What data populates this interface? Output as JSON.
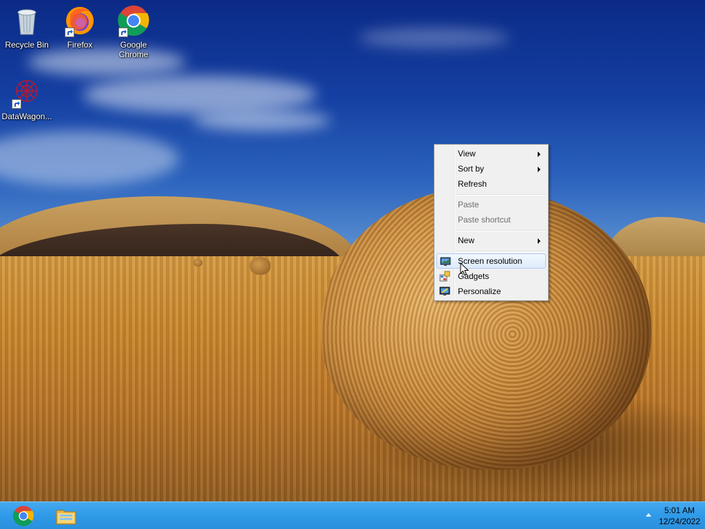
{
  "desktop": {
    "icons": [
      {
        "label": "Recycle Bin",
        "icon": "recycle-bin-icon"
      },
      {
        "label": "Firefox",
        "icon": "firefox-icon"
      },
      {
        "label": "Google Chrome",
        "icon": "chrome-icon"
      },
      {
        "label": "DataWagon...",
        "icon": "datawagon-icon"
      }
    ]
  },
  "context_menu": {
    "items": [
      {
        "label": "View",
        "submenu": true,
        "enabled": true
      },
      {
        "label": "Sort by",
        "submenu": true,
        "enabled": true
      },
      {
        "label": "Refresh",
        "submenu": false,
        "enabled": true
      },
      {
        "label": "Paste",
        "submenu": false,
        "enabled": false
      },
      {
        "label": "Paste shortcut",
        "submenu": false,
        "enabled": false
      },
      {
        "label": "New",
        "submenu": true,
        "enabled": true
      },
      {
        "label": "Screen resolution",
        "icon": "screen-resolution-icon",
        "enabled": true,
        "highlighted": true
      },
      {
        "label": "Gadgets",
        "icon": "gadgets-icon",
        "enabled": true
      },
      {
        "label": "Personalize",
        "icon": "personalize-icon",
        "enabled": true
      }
    ]
  },
  "taskbar": {
    "pinned": [
      {
        "icon": "chrome-icon"
      },
      {
        "icon": "file-explorer-icon"
      }
    ],
    "tray": {
      "time": "5:01 AM",
      "date": "12/24/2022"
    }
  },
  "colors": {
    "taskbar": "#2f9ae8",
    "menu_background": "#f0f0f0",
    "menu_highlight_border": "#aeccf0",
    "sky": "#143fa2"
  }
}
